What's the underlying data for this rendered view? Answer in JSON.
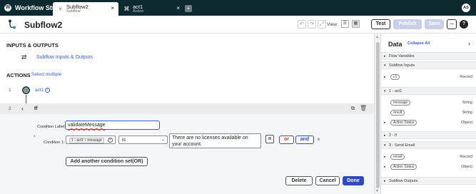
{
  "app": {
    "title": "Workflow Studio",
    "logo_text": "W"
  },
  "tabs": [
    {
      "name": "Subflow2",
      "sub": "Subflow",
      "close": "×"
    },
    {
      "name": "act1",
      "sub": "Action",
      "close": "×"
    }
  ],
  "add_tab": "+",
  "user": {
    "initials": "AS"
  },
  "header": {
    "title": "Subflow2",
    "undo_icon": "↶",
    "redo_icon": "↷",
    "expand_icon": "⤢",
    "view_label": "View:",
    "test_label": "Test",
    "publish_label": "Publish",
    "save_label": "Save",
    "more_label": "...",
    "help_label": "?"
  },
  "io": {
    "heading": "INPUTS & OUTPUTS",
    "link": "Subflow Inputs & Outputs",
    "icon": "⇄"
  },
  "actions": {
    "heading": "ACTIONS",
    "select_multiple": "Select multiple",
    "step1": {
      "num": "1",
      "label": "act1",
      "info": "i"
    },
    "step2": {
      "num": "2",
      "name": "If",
      "arrow": "‹"
    }
  },
  "condition": {
    "label_text": "Condition Label:",
    "label_value": "validateMessage",
    "marker": "*",
    "cond1_label": "Condition 1:",
    "variable_chip": "1 - act1 ‣ message",
    "chip_close": "×",
    "operator": "is",
    "value": "There are no licenses available on your account.",
    "picker_icon": "⊞",
    "or_label": "or",
    "and_label": "and",
    "remove": "×",
    "add_set_label": "Add another condition set(OR)"
  },
  "footer": {
    "delete_label": "Delete",
    "cancel_label": "Cancel",
    "done_label": "Done"
  },
  "data_panel": {
    "title": "Data",
    "collapse_label": "Collapse All",
    "close_icon": "›",
    "sections": [
      {
        "title": "Flow Variables",
        "arrow": "▸"
      },
      {
        "title": "Subflow Inputs",
        "arrow": "▾"
      },
      {
        "title": "1 - act1",
        "arrow": "▾"
      },
      {
        "title": "2 - If",
        "arrow": "▸"
      },
      {
        "title": "3 - Send Email",
        "arrow": "▾"
      },
      {
        "title": "Subflow Outputs",
        "arrow": "▸"
      }
    ],
    "pills": [
      {
        "name": "c1",
        "type": "Record",
        "arrow": "▸"
      },
      {
        "name": "message",
        "type": "String",
        "arrow": ""
      },
      {
        "name": "result",
        "type": "String",
        "arrow": ""
      },
      {
        "name": "Action Status",
        "type": "Object",
        "arrow": "▸"
      },
      {
        "name": "email",
        "type": "Record",
        "arrow": "▸"
      },
      {
        "name": "Action Status",
        "type": "Object",
        "arrow": "▸"
      }
    ]
  },
  "colors": {
    "topbar": "#0e2a31",
    "accent": "#2d4abf",
    "link": "#3a5ad6",
    "or": "#c0392b",
    "disabled_button": "#c9cfeb"
  }
}
